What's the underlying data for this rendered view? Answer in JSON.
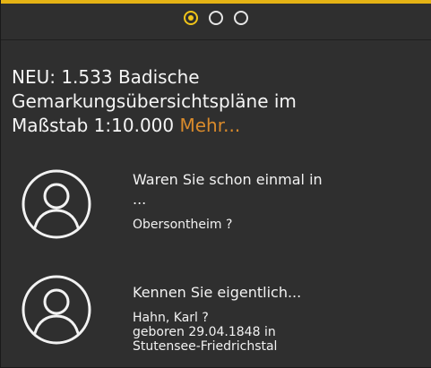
{
  "carousel": {
    "slides": 3,
    "active_index": 0
  },
  "news": {
    "headline_line1": "NEU: 1.533 Badische",
    "headline_line2": "Gemarkungsübersichtspläne im",
    "headline_line3": "Maßstab 1:10.000",
    "more_label": "Mehr..."
  },
  "items": [
    {
      "question_line1": "Waren Sie schon einmal in",
      "question_line2": "...",
      "answer": "Obersontheim ?"
    },
    {
      "question_line1": "Kennen Sie eigentlich...",
      "answer_line1": "Hahn, Karl ?",
      "answer_line2": "geboren 29.04.1848 in",
      "answer_line3": "Stutensee-Friedrichstal"
    }
  ],
  "icons": {
    "avatar": "user-avatar-icon",
    "dot": "carousel-dot-icon"
  },
  "colors": {
    "background": "#2f2f2f",
    "accent": "#f0c419",
    "link": "#d98a2b",
    "text": "#f2f2f2"
  }
}
